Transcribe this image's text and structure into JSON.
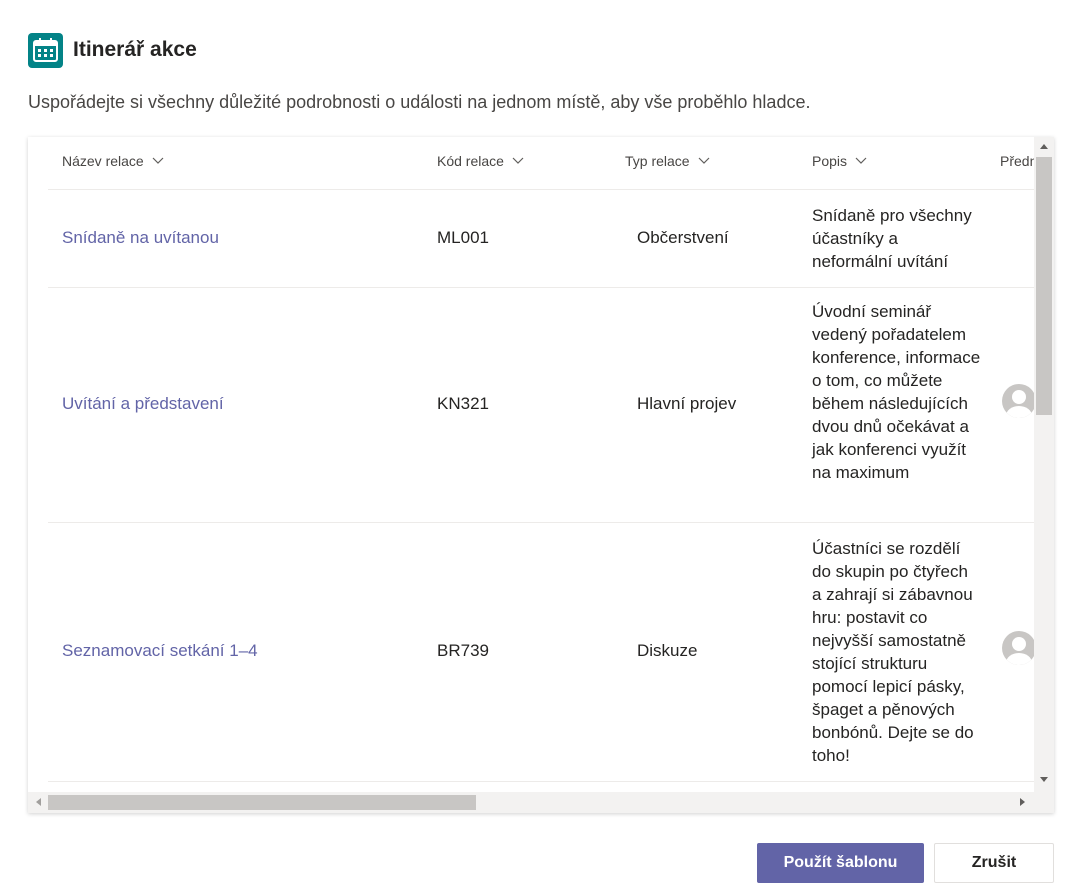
{
  "header": {
    "title": "Itinerář akce",
    "icon": "calendar-icon"
  },
  "subtitle": "Uspořádejte si všechny důležité podrobnosti o události na jednom místě, aby vše proběhlo hladce.",
  "table": {
    "columns": [
      "Název relace",
      "Kód relace",
      "Typ relace",
      "Popis",
      "Předn"
    ],
    "rows": [
      {
        "name": "Snídaně na uvítanou",
        "code": "ML001",
        "type": "Občerstvení",
        "description": "Snídaně pro všechny účastníky a neformální uvítání",
        "has_avatar": false
      },
      {
        "name": "Uvítání a představení",
        "code": "KN321",
        "type": "Hlavní projev",
        "description": "Úvodní seminář vedený pořadatelem konference, informace o tom, co můžete během následujících dvou dnů očekávat a jak konferenci využít na maximum",
        "has_avatar": true
      },
      {
        "name": "Seznamovací setkání 1–4",
        "code": "BR739",
        "type": "Diskuze",
        "description": "Účastníci se rozdělí do skupin po čtyřech a zahrají si zábavnou hru: postavit co nejvyšší samostatně stojící strukturu pomocí lepicí pásky, špaget a pěnových bonbónů. Dejte se do toho!",
        "has_avatar": true
      }
    ]
  },
  "footer": {
    "apply_label": "Použít šablonu",
    "cancel_label": "Zrušit"
  },
  "colors": {
    "accent": "#6264a7",
    "icon_bg": "#038387"
  }
}
